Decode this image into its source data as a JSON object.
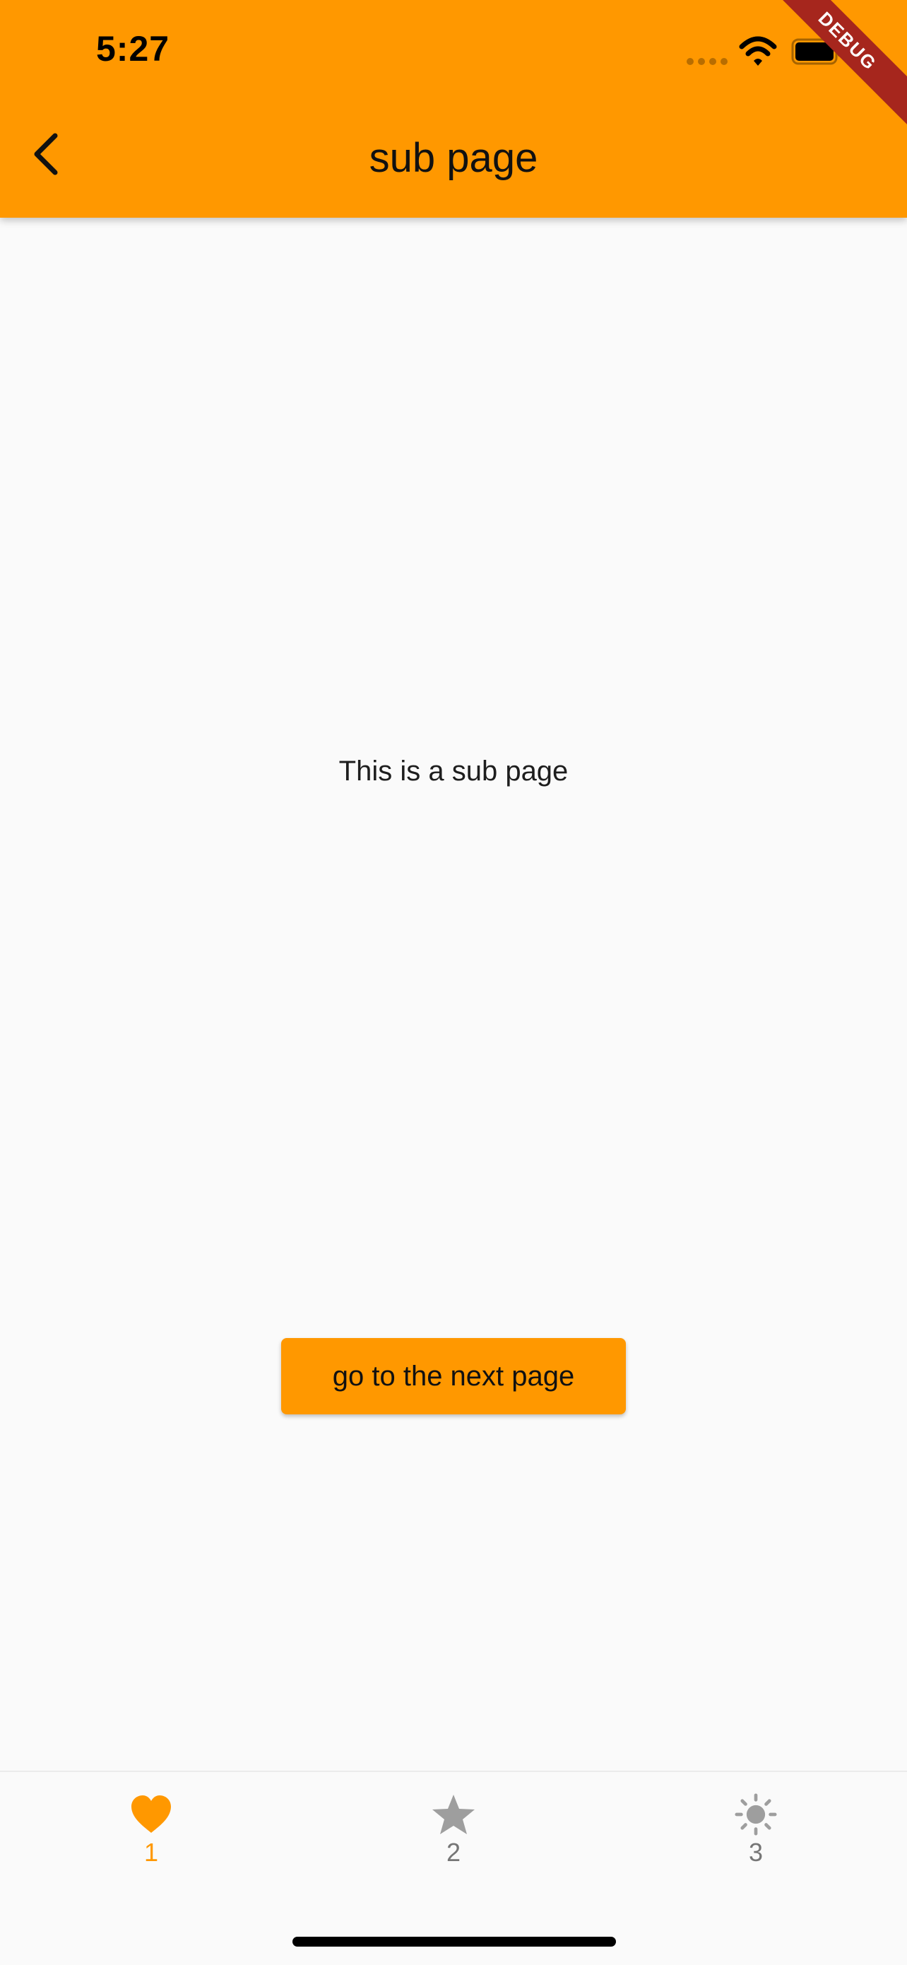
{
  "status_bar": {
    "time": "5:27",
    "debug_label": "DEBUG"
  },
  "app_bar": {
    "title": "sub page",
    "back_icon": "chevron-left-icon",
    "color": "#ff9800"
  },
  "main": {
    "text": "This is a sub page",
    "button_label": "go to the next page"
  },
  "bottom_nav": {
    "items": [
      {
        "label": "1",
        "icon": "heart-icon",
        "active": true
      },
      {
        "label": "2",
        "icon": "star-icon",
        "active": false
      },
      {
        "label": "3",
        "icon": "sun-icon",
        "active": false
      }
    ],
    "active_color": "#ff9800",
    "inactive_color": "#9e9e9e"
  }
}
